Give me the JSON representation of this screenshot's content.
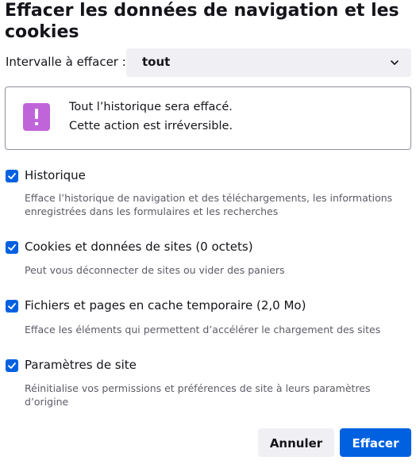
{
  "dialog": {
    "title": "Effacer les données de navigation et les cookies"
  },
  "range": {
    "label": "Intervalle à effacer :",
    "selected": "tout"
  },
  "warning": {
    "line1": "Tout l’historique sera effacé.",
    "line2": "Cette action est irréversible.",
    "icon": "warning-icon",
    "icon_color": "#c064da"
  },
  "options": [
    {
      "label": "Historique",
      "description": "Efface l’historique de navigation et des téléchargements, les informations enregistrées dans les formulaires et les recherches",
      "checked": true
    },
    {
      "label": "Cookies et données de sites (0 octets)",
      "description": "Peut vous déconnecter de sites ou vider des paniers",
      "checked": true
    },
    {
      "label": "Fichiers et pages en cache temporaire (2,0 Mo)",
      "description": "Efface les éléments qui permettent d’accélérer le chargement des sites",
      "checked": true
    },
    {
      "label": "Paramètres de site",
      "description": "Réinitialise vos permissions et préférences de site à leurs paramètres d’origine",
      "checked": true
    }
  ],
  "buttons": {
    "cancel": "Annuler",
    "clear": "Effacer"
  },
  "colors": {
    "accent": "#0061e0",
    "button_secondary": "#f0f0f4",
    "text": "#15141a",
    "description_text": "#5b5b66"
  }
}
